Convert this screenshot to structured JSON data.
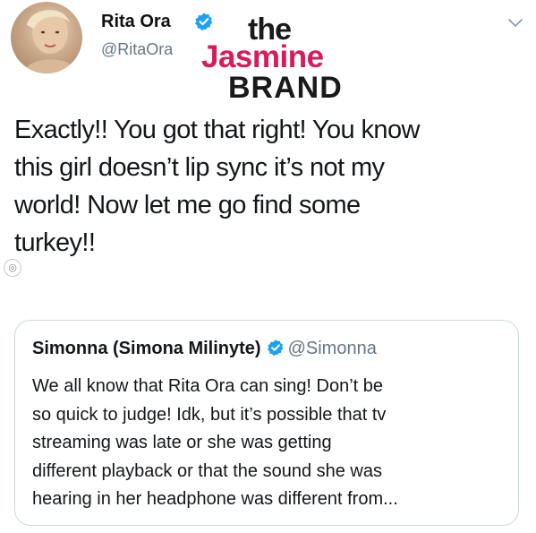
{
  "tweet": {
    "author_name": "Rita Ora",
    "author_handle": "@RitaOra",
    "verified": true,
    "text_lines": [
      "Exactly!! You got that right! You know",
      "this girl doesn’t lip sync it’s not my",
      "world! Now let me go find some",
      "turkey!!"
    ],
    "menu_icon": "chevron-down-icon"
  },
  "watermark": {
    "line1": "the",
    "line2": "Jasmine",
    "line3": "BRAND",
    "accent_color": "#d51c5d"
  },
  "quoted_tweet": {
    "author_name": "Simonna (Simona Milinyte)",
    "author_handle": "@Simonna",
    "verified": true,
    "text_lines": [
      "We all know that Rita Ora can sing! Don’t be",
      "so quick to judge!  Idk, but it’s possible that tv",
      "streaming was late or she was getting",
      "different playback or that the sound she was",
      "hearing in her headphone was different from..."
    ]
  },
  "colors": {
    "verified_blue": "#1da1f2",
    "handle_gray": "#657786",
    "text_dark": "#14171a",
    "card_border": "#cfd9de"
  }
}
